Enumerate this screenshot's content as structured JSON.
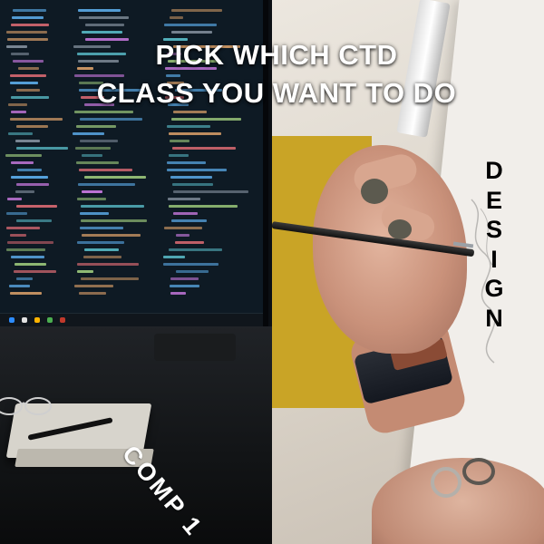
{
  "title": {
    "line1": "PICK WHICH CTD",
    "line2": "CLASS YOU WANT TO DO"
  },
  "options": [
    {
      "label": "DESIGN",
      "letters": [
        "D",
        "E",
        "S",
        "I",
        "G",
        "N"
      ],
      "photo": "hand-drawing-photo"
    },
    {
      "label": "COMP 1",
      "photo": "coding-monitor-photo"
    }
  ],
  "colors": {
    "title_text": "#ffffff",
    "design_text": "#000000",
    "comp_text": "#ffffff",
    "monitor_bg": "#0e1a24",
    "wall_yellow": "#c9a426"
  }
}
